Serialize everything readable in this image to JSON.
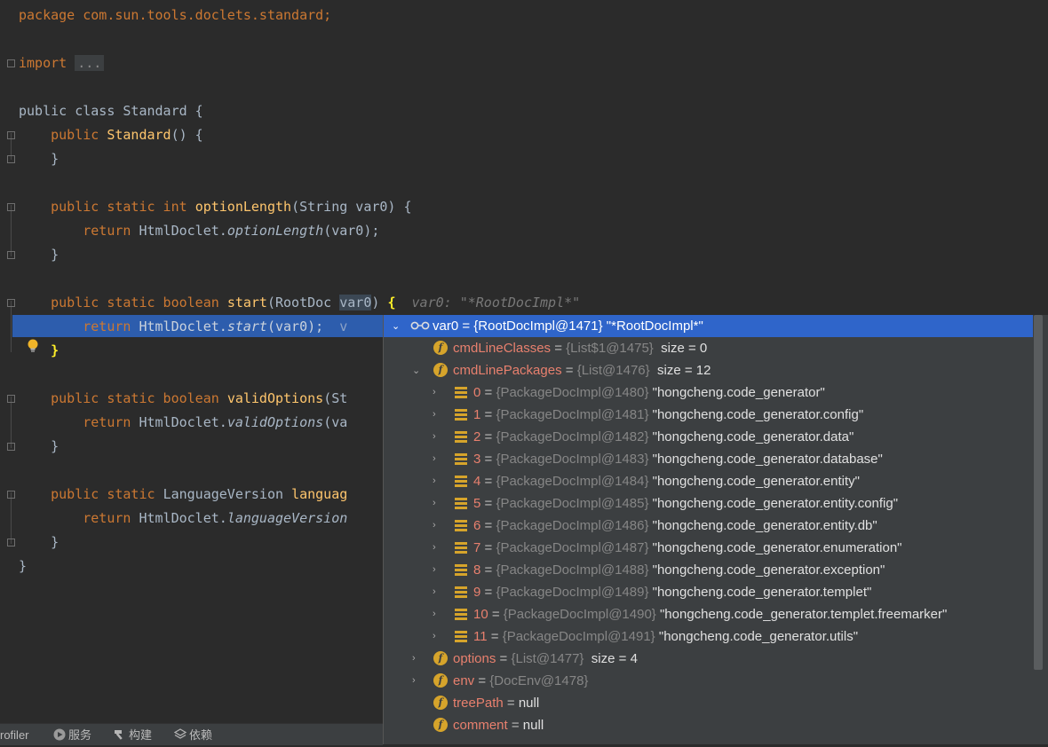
{
  "code": {
    "package_line": "package com.sun.tools.doclets.standard;",
    "import_keyword": "import",
    "import_fold": "...",
    "class_line": "public class Standard {",
    "ctor_kw": "public",
    "ctor_name": "Standard",
    "ctor_rest": "() {",
    "close_ctor": "}",
    "m1_kw": "public static int",
    "m1_name": "optionLength",
    "m1_rest": "(String var0) {",
    "m1_ret_kw": "return",
    "m1_ret_obj": "HtmlDoclet.",
    "m1_ret_call": "optionLength",
    "m1_ret_args": "(var0);",
    "close_m1": "}",
    "m2_kw": "public static boolean",
    "m2_name": "start",
    "m2_rest_a": "(RootDoc ",
    "m2_var": "var0",
    "m2_rest_b": ") ",
    "m2_brace": "{",
    "m2_inlay": "var0: \"*RootDocImpl*\"",
    "m2_ret_kw": "return",
    "m2_ret_obj": "HtmlDoclet.",
    "m2_ret_call": "start",
    "m2_ret_args": "(var0);",
    "m2_ret_tail": "v",
    "close_m2": "}",
    "m3_kw": "public static boolean",
    "m3_name": "validOptions",
    "m3_rest": "(St",
    "m3_ret_kw": "return",
    "m3_ret_obj": "HtmlDoclet.",
    "m3_ret_call": "validOptions",
    "m3_ret_args": "(va",
    "close_m3": "}",
    "m4_kw": "public static",
    "m4_type": "LanguageVersion",
    "m4_name": "languag",
    "m4_ret_kw": "return",
    "m4_ret_obj": "HtmlDoclet.",
    "m4_ret_call": "languageVersion",
    "close_m4": "}",
    "close_class": "}"
  },
  "debug_popup": {
    "root": {
      "name": "var0",
      "eq": " = ",
      "type": "{RootDocImpl@1471}",
      "value": "\"*RootDocImpl*\""
    },
    "cmdLineClasses": {
      "name": "cmdLineClasses",
      "eq": " = ",
      "type": "{List$1@1475}",
      "value": "size = 0"
    },
    "cmdLinePackages": {
      "name": "cmdLinePackages",
      "eq": " = ",
      "type": "{List@1476}",
      "value": "size = 12"
    },
    "packages": [
      {
        "index": "0",
        "type": "{PackageDocImpl@1480}",
        "value": "\"hongcheng.code_generator\""
      },
      {
        "index": "1",
        "type": "{PackageDocImpl@1481}",
        "value": "\"hongcheng.code_generator.config\""
      },
      {
        "index": "2",
        "type": "{PackageDocImpl@1482}",
        "value": "\"hongcheng.code_generator.data\""
      },
      {
        "index": "3",
        "type": "{PackageDocImpl@1483}",
        "value": "\"hongcheng.code_generator.database\""
      },
      {
        "index": "4",
        "type": "{PackageDocImpl@1484}",
        "value": "\"hongcheng.code_generator.entity\""
      },
      {
        "index": "5",
        "type": "{PackageDocImpl@1485}",
        "value": "\"hongcheng.code_generator.entity.config\""
      },
      {
        "index": "6",
        "type": "{PackageDocImpl@1486}",
        "value": "\"hongcheng.code_generator.entity.db\""
      },
      {
        "index": "7",
        "type": "{PackageDocImpl@1487}",
        "value": "\"hongcheng.code_generator.enumeration\""
      },
      {
        "index": "8",
        "type": "{PackageDocImpl@1488}",
        "value": "\"hongcheng.code_generator.exception\""
      },
      {
        "index": "9",
        "type": "{PackageDocImpl@1489}",
        "value": "\"hongcheng.code_generator.templet\""
      },
      {
        "index": "10",
        "type": "{PackageDocImpl@1490}",
        "value": "\"hongcheng.code_generator.templet.freemarker\""
      },
      {
        "index": "11",
        "type": "{PackageDocImpl@1491}",
        "value": "\"hongcheng.code_generator.utils\""
      }
    ],
    "options": {
      "name": "options",
      "eq": " = ",
      "type": "{List@1477}",
      "value": "size = 4"
    },
    "env": {
      "name": "env",
      "eq": " = ",
      "type": "{DocEnv@1478}",
      "value": ""
    },
    "treePath": {
      "name": "treePath",
      "eq": " = ",
      "type": "",
      "value": "null"
    },
    "comment": {
      "name": "comment",
      "eq": " = ",
      "type": "",
      "value": "null"
    },
    "field_icon_letter": "f",
    "separator": " = "
  },
  "statusbar": {
    "profiler": "rofiler",
    "services": "服务",
    "build": "构建",
    "deps": "依赖"
  },
  "colors": {
    "editor_bg": "#2b2b2b",
    "keyword": "#cc7832",
    "method": "#ffc66d",
    "selection": "#2f65ca",
    "field_icon": "#d6a42b",
    "field_name": "#e8806e"
  },
  "icons": [
    "glasses-icon",
    "field-icon",
    "array-element-icon",
    "lightbulb-icon",
    "run-icon",
    "hammer-icon",
    "layers-icon",
    "fold-marker-icon",
    "expand-arrow-icon",
    "collapse-arrow-icon"
  ]
}
